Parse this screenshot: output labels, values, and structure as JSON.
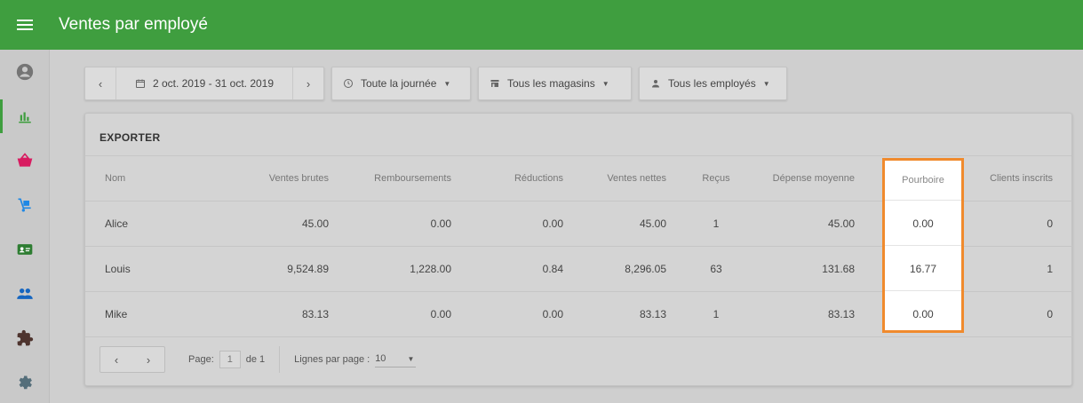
{
  "app": {
    "title": "Ventes par employé"
  },
  "sidebar": {
    "items": [
      {
        "icon": "account-circle-icon"
      },
      {
        "icon": "bar-chart-icon",
        "active": true
      },
      {
        "icon": "basket-icon"
      },
      {
        "icon": "hand-truck-icon"
      },
      {
        "icon": "id-card-icon"
      },
      {
        "icon": "people-icon"
      },
      {
        "icon": "puzzle-icon"
      },
      {
        "icon": "settings-icon"
      }
    ]
  },
  "filters": {
    "date_range": "2 oct. 2019 - 31 oct. 2019",
    "time": "Toute la journée",
    "stores": "Tous les magasins",
    "employees": "Tous les employés"
  },
  "report": {
    "export_label": "EXPORTER",
    "columns": [
      "Nom",
      "Ventes brutes",
      "Remboursements",
      "Réductions",
      "Ventes nettes",
      "Reçus",
      "Dépense moyenne",
      "Pourboire",
      "Clients inscrits"
    ],
    "rows": [
      [
        "Alice",
        "45.00",
        "0.00",
        "0.00",
        "45.00",
        "1",
        "45.00",
        "0.00",
        "0"
      ],
      [
        "Louis",
        "9,524.89",
        "1,228.00",
        "0.84",
        "8,296.05",
        "63",
        "131.68",
        "16.77",
        "1"
      ],
      [
        "Mike",
        "83.13",
        "0.00",
        "0.00",
        "83.13",
        "1",
        "83.13",
        "0.00",
        "0"
      ]
    ]
  },
  "pagination": {
    "page_label": "Page:",
    "page_value": "1",
    "of_label": "de 1",
    "rows_label": "Lignes par page :",
    "rows_value": "10"
  },
  "colors": {
    "brand": "#3f9e3f",
    "highlight": "#f08a2d"
  }
}
